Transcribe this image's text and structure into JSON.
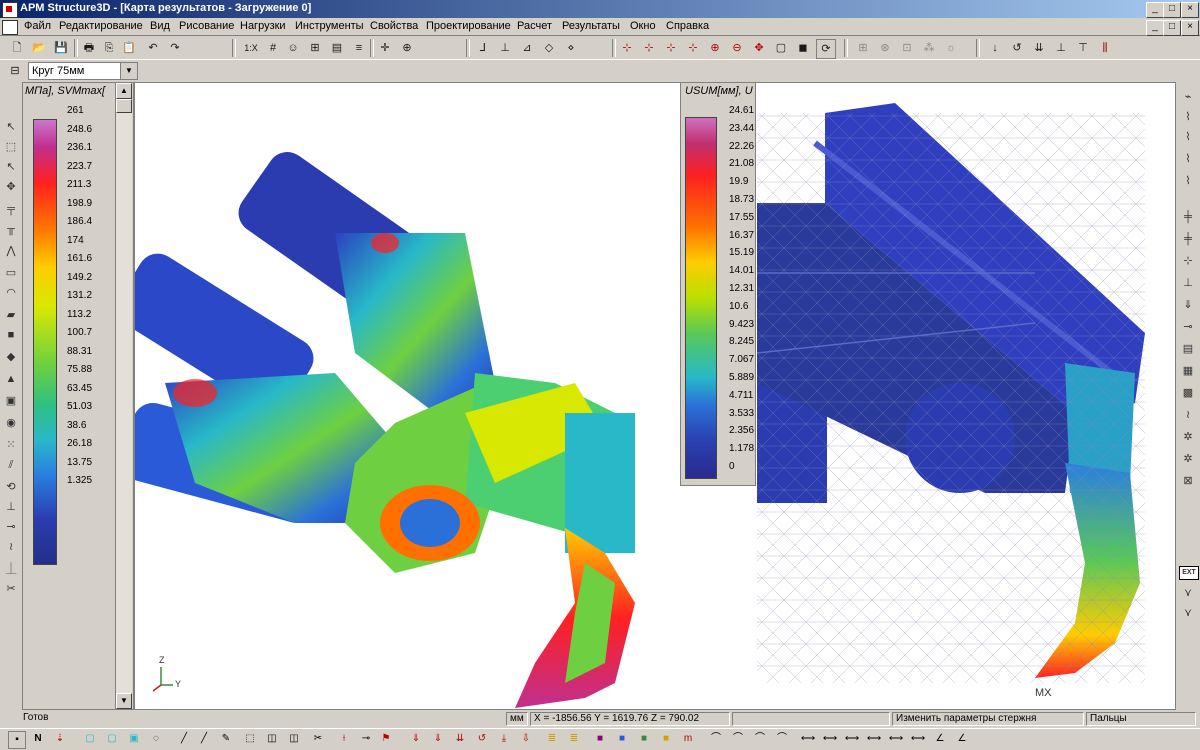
{
  "window": {
    "title": "APM Structure3D - [Карта результатов - Загружение 0]",
    "controls": [
      "_",
      "□",
      "×"
    ]
  },
  "menu": [
    "Файл",
    "Редактирование",
    "Вид",
    "Рисование",
    "Нагрузки",
    "Инструменты",
    "Свойства",
    "Проектирование",
    "Расчет",
    "Результаты",
    "Окно",
    "Справка"
  ],
  "menu_right_controls": [
    "_",
    "□",
    "×"
  ],
  "toolbar": {
    "zoom_label": "1:X"
  },
  "section_select": {
    "value": "Круг 75мм"
  },
  "stress_legend": {
    "title": "МПа], SVMmax[",
    "values": [
      "261",
      "248.6",
      "236.1",
      "223.7",
      "211.3",
      "198.9",
      "186.4",
      "174",
      "161.6",
      "149.2",
      "131.2",
      "113.2",
      "100.7",
      "88.31",
      "75.88",
      "63.45",
      "51.03",
      "38.6",
      "26.18",
      "13.75",
      "1.325"
    ],
    "colors": {
      "max": "#c03090",
      "high": "#ff2020",
      "mid": "#6ed040",
      "low": "#22308a"
    }
  },
  "displacement_legend": {
    "title": "USUM[мм], U",
    "values": [
      "24.61",
      "23.44",
      "22.26",
      "21.08",
      "19.9",
      "18.73",
      "17.55",
      "16.37",
      "15.19",
      "14.01",
      "12.31",
      "10.6",
      "9.423",
      "8.245",
      "7.067",
      "5.889",
      "4.711",
      "3.533",
      "2.356",
      "1.178",
      "0"
    ]
  },
  "viewport": {
    "axis_z": "Z",
    "axis_y": "Y",
    "max_label": "MX"
  },
  "status": {
    "ready": "Готов",
    "units": "мм",
    "coords": "X = -1856.56 Y = 1619.76 Z = 790.02",
    "hint": "Изменить параметры стержня",
    "layer": "Пальцы"
  },
  "bottom_toolbar": {
    "node_label": "N"
  }
}
